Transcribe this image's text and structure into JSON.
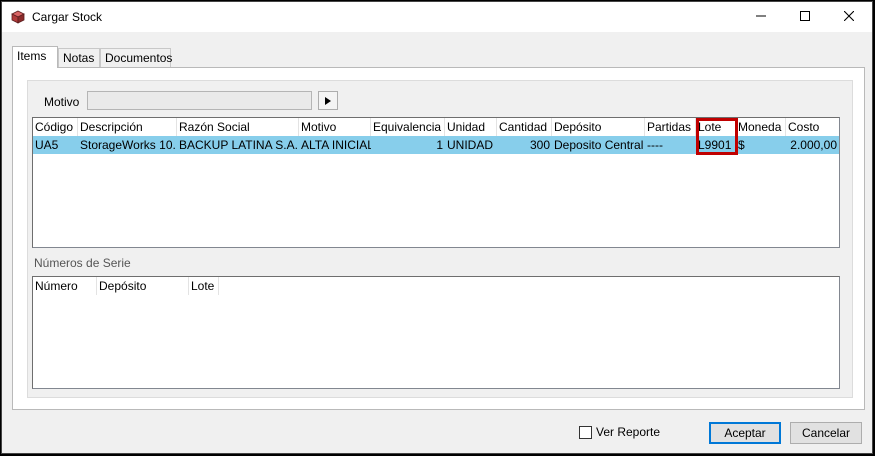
{
  "window": {
    "title": "Cargar Stock"
  },
  "tabs": [
    {
      "label": "Items"
    },
    {
      "label": "Notas"
    },
    {
      "label": "Documentos"
    }
  ],
  "motivo": {
    "label": "Motivo",
    "value": ""
  },
  "items_table": {
    "columns": [
      "Código",
      "Descripción",
      "Razón Social",
      "Motivo",
      "Equivalencia",
      "Unidad",
      "Cantidad",
      "Depósito",
      "Partidas",
      "Lote",
      "Moneda",
      "Costo"
    ],
    "rows": [
      {
        "codigo": "UA5",
        "descripcion": "StorageWorks 10.",
        "razon_social": "BACKUP LATINA S.A.",
        "motivo": "ALTA INICIAL",
        "equivalencia": "1",
        "unidad": "UNIDAD",
        "cantidad": "300",
        "deposito": "Deposito Central",
        "partidas": "----",
        "lote": "L9901",
        "moneda": "$",
        "costo": "2.000,00"
      }
    ]
  },
  "serie": {
    "title": "Números de Serie",
    "columns": [
      "Número",
      "Depósito",
      "Lote"
    ]
  },
  "footer": {
    "ver_reporte_label": "Ver Reporte",
    "ver_reporte_checked": false,
    "aceptar_label": "Aceptar",
    "cancelar_label": "Cancelar"
  },
  "colors": {
    "selected_row": "#87ceeb",
    "highlight_box": "#c00000",
    "default_button_border": "#0078d7"
  },
  "icons": {
    "app": "cube-icon",
    "minimize": "minimize-icon",
    "maximize": "maximize-icon",
    "close": "close-icon",
    "motivo_lookup": "play-arrow-icon"
  }
}
